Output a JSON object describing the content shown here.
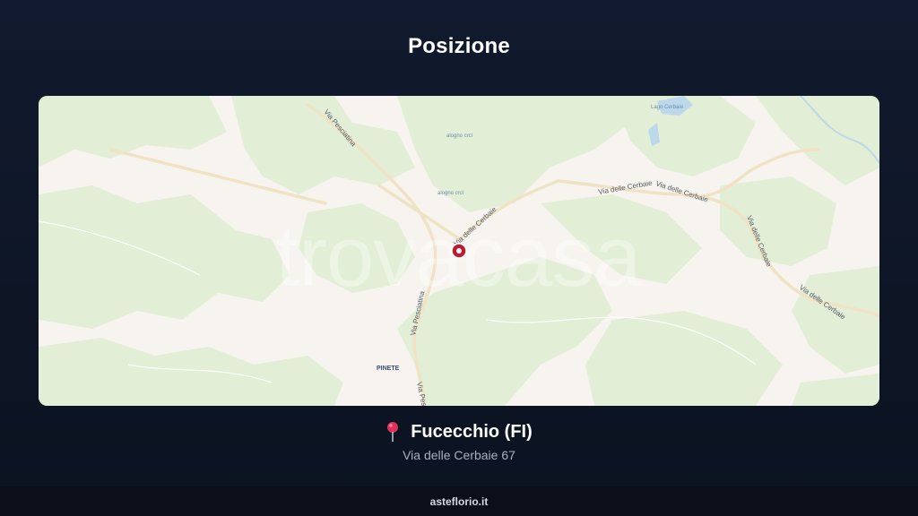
{
  "page": {
    "title": "Posizione"
  },
  "map": {
    "watermark": "trovacasa",
    "road_labels": {
      "pesciatina_top": "Via Pesciatina",
      "pesciatina_mid": "Via Pesciatina",
      "pesciatina_bottom": "Via Pesc",
      "cerbaie_center": "Via delle Cerbaie",
      "cerbaie_east1": "Via delle Cerbaie",
      "cerbaie_east2": "Via delle Cerbaie",
      "cerbaie_vertical": "Via delle Cerbaie",
      "cerbaie_se": "Via delle Cerbaie"
    },
    "area_labels": {
      "lake": "Lago Cerbaie",
      "area1": "alogno crcl",
      "area2": "alogno crcl"
    },
    "place_label": "PINETE",
    "colors": {
      "forest": "#e2eed6",
      "land": "#f7f4ef",
      "marker": "#c0192b",
      "water": "#bcd8ea"
    }
  },
  "location": {
    "icon": "pushpin-icon",
    "name": "Fucecchio (FI)",
    "address": "Via delle Cerbaie 67"
  },
  "footer": {
    "text": "asteflorio.it"
  }
}
